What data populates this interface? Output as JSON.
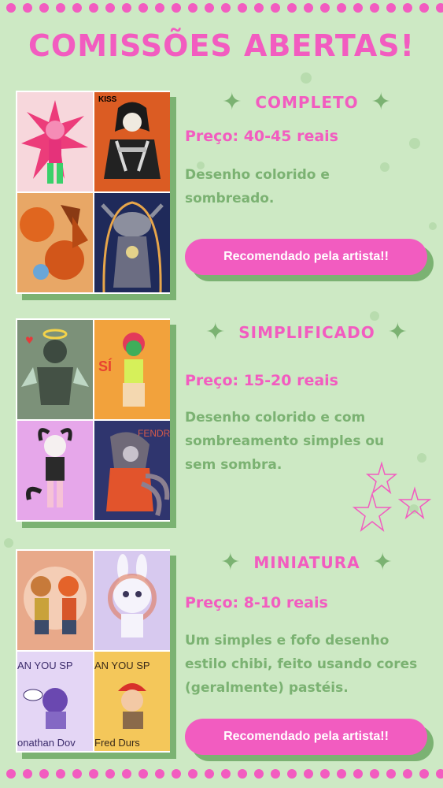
{
  "title": "COMISSÕES ABERTAS!",
  "sections": [
    {
      "heading": "COMPLETO",
      "price": "Preço: 40-45 reais",
      "description": "Desenho colorido e sombreado.",
      "button": "Recomendado pela artista!!"
    },
    {
      "heading": "SIMPLIFICADO",
      "price": "Preço: 15-20 reais",
      "description": "Desenho colorido e com sombreamento simples ou sem sombra."
    },
    {
      "heading": "MINIATURA",
      "price": "Preço: 8-10 reais",
      "description": "Um simples e fofo desenho estilo chibi, feito usando cores (geralmente) pastéis.",
      "button": "Recomendado pela artista!!"
    }
  ],
  "gallery_text": {
    "kiss": "KISS",
    "cant_you_1": "AN YOU SP",
    "cant_you_2": "AN YOU SP",
    "name_1": "onathan Dov",
    "name_2": "Fred Durs",
    "si": "SÍ",
    "fendr": "FENDR"
  },
  "colors": {
    "background": "#cde9c4",
    "accent_pink": "#f25cc0",
    "accent_green": "#7bb272"
  }
}
